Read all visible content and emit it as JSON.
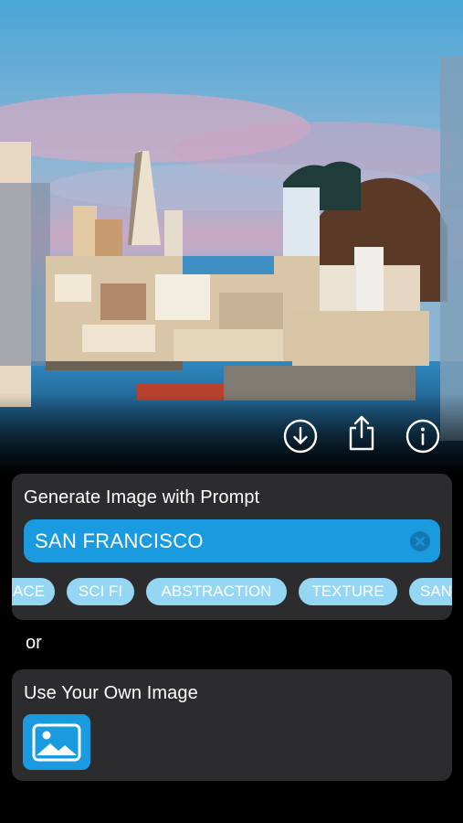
{
  "hero": {
    "image": "san-francisco-skyline-generated",
    "actions": [
      {
        "id": "download",
        "icon": "download-circle-icon"
      },
      {
        "id": "share",
        "icon": "share-icon"
      },
      {
        "id": "info",
        "icon": "info-circle-icon"
      }
    ]
  },
  "generate": {
    "title": "Generate Image with Prompt",
    "prompt_value": "SAN FRANCISCO",
    "clear_icon": "clear-circle-icon",
    "chips": [
      "ACE",
      "SCI FI",
      "ABSTRACTION",
      "TEXTURE",
      "SAN"
    ]
  },
  "divider_text": "or",
  "own_image": {
    "title": "Use Your Own Image",
    "picker_icon": "photo-icon"
  },
  "colors": {
    "accent": "#1a9be0",
    "chip": "#96d6f5",
    "card": "#2c2c2e",
    "background": "#000000"
  }
}
